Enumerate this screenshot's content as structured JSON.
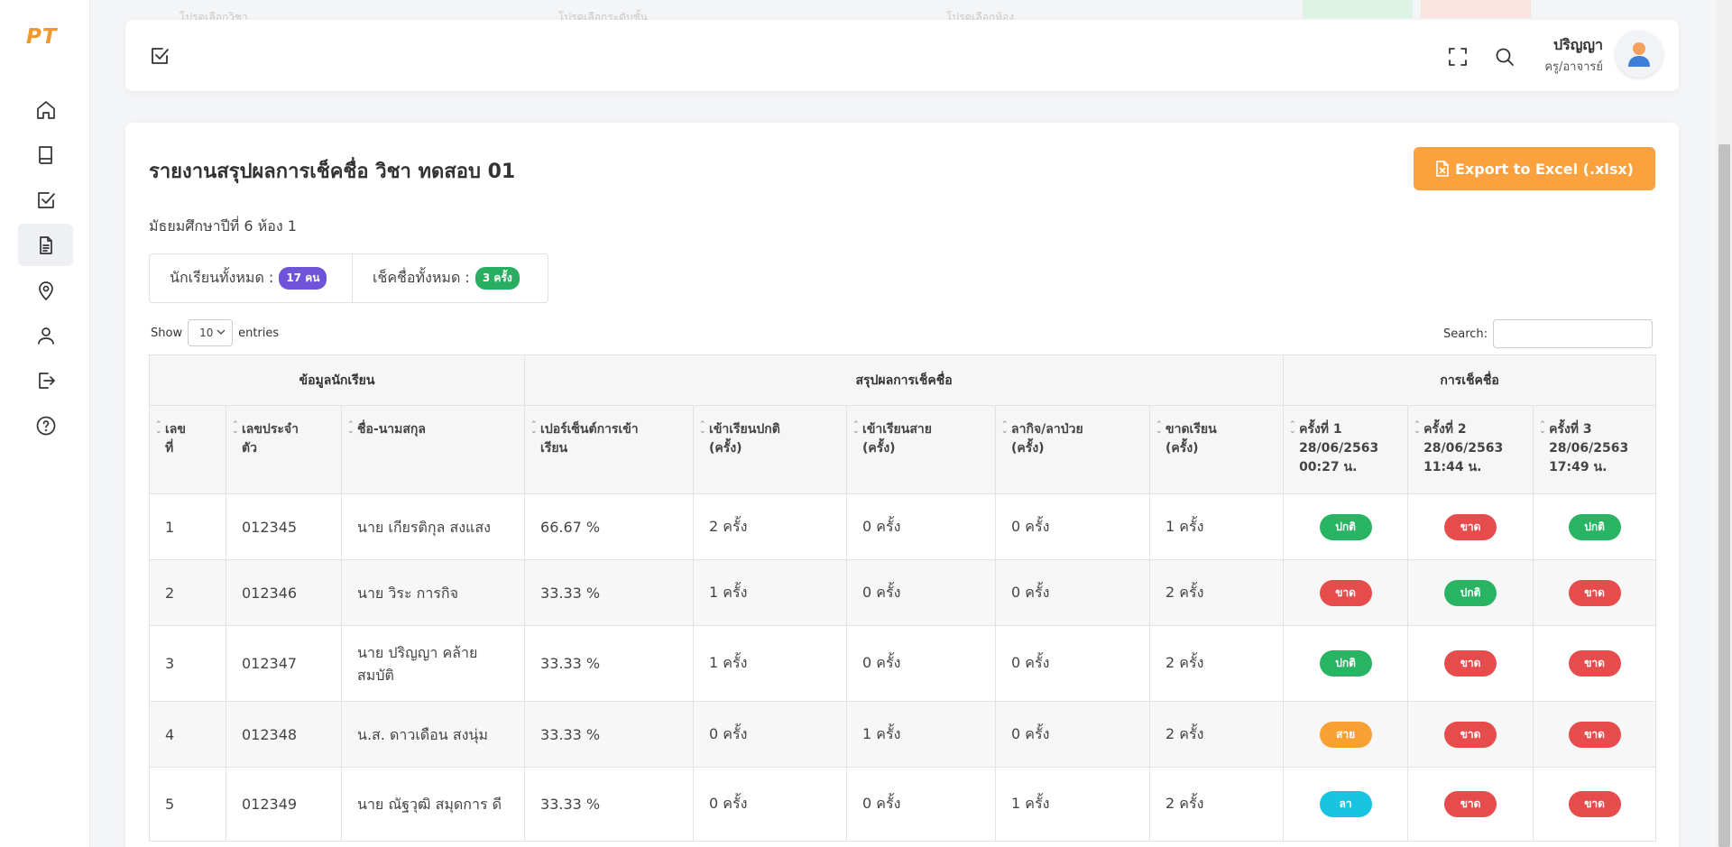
{
  "app": {
    "logo": "PT"
  },
  "sidebar": {
    "items": [
      {
        "name": "home",
        "icon": "home-icon"
      },
      {
        "name": "book",
        "icon": "book-icon"
      },
      {
        "name": "checkin",
        "icon": "checkbox-icon"
      },
      {
        "name": "report",
        "icon": "document-icon",
        "active": true
      },
      {
        "name": "location",
        "icon": "map-pin-icon"
      },
      {
        "name": "profile",
        "icon": "user-icon"
      },
      {
        "name": "logout",
        "icon": "logout-icon"
      },
      {
        "name": "help",
        "icon": "help-icon"
      }
    ]
  },
  "header": {
    "user_name": "ปริญญา",
    "user_role": "ครู/อาจารย์"
  },
  "report": {
    "title": "รายงานสรุปผลการเช็คชื่อ วิชา ทดสอบ 01",
    "export_label": "Export to Excel (.xlsx)",
    "class_label": "มัธยมศึกษาปีที่ 6 ห้อง 1",
    "students_label": "นักเรียนทั้งหมด :",
    "students_count": "17 คน",
    "checks_label": "เช็คชื่อทั้งหมด :",
    "checks_count": "3 ครั้ง"
  },
  "table_controls": {
    "show_label": "Show",
    "entries_value": "10",
    "entries_label": "entries",
    "search_label": "Search:"
  },
  "table": {
    "groups": [
      "ข้อมูลนักเรียน",
      "สรุปผลการเช็คชื่อ",
      "การเช็คชื่อ"
    ],
    "columns": [
      [
        "เลข",
        "ที่"
      ],
      [
        "เลขประจำ",
        "ตัว"
      ],
      [
        "ชื่อ-นามสกุล"
      ],
      [
        "เปอร์เซ็นต์การเข้า",
        "เรียน"
      ],
      [
        "เข้าเรียนปกติ",
        "(ครั้ง)"
      ],
      [
        "เข้าเรียนสาย",
        "(ครั้ง)"
      ],
      [
        "ลากิจ/ลาป่วย",
        "(ครั้ง)"
      ],
      [
        "ขาดเรียน",
        "(ครั้ง)"
      ],
      [
        "ครั้งที่ 1",
        "28/06/2563",
        "00:27 น."
      ],
      [
        "ครั้งที่ 2",
        "28/06/2563",
        "11:44 น."
      ],
      [
        "ครั้งที่ 3",
        "28/06/2563",
        "17:49 น."
      ]
    ],
    "rows": [
      {
        "no": "1",
        "id": "012345",
        "name": "นาย เกียรติกุล สงแสง",
        "percent": "66.67 %",
        "normal": "2 ครั้ง",
        "late": "0 ครั้ง",
        "leave": "0 ครั้ง",
        "absent": "1 ครั้ง",
        "checks": [
          {
            "label": "ปกติ",
            "status": "normal"
          },
          {
            "label": "ขาด",
            "status": "absent"
          },
          {
            "label": "ปกติ",
            "status": "normal"
          }
        ]
      },
      {
        "no": "2",
        "id": "012346",
        "name": "นาย วิระ การกิจ",
        "percent": "33.33 %",
        "normal": "1 ครั้ง",
        "late": "0 ครั้ง",
        "leave": "0 ครั้ง",
        "absent": "2 ครั้ง",
        "checks": [
          {
            "label": "ขาด",
            "status": "absent"
          },
          {
            "label": "ปกติ",
            "status": "normal"
          },
          {
            "label": "ขาด",
            "status": "absent"
          }
        ]
      },
      {
        "no": "3",
        "id": "012347",
        "name": "นาย ปริญญา คล้าย สมบัติ",
        "percent": "33.33 %",
        "normal": "1 ครั้ง",
        "late": "0 ครั้ง",
        "leave": "0 ครั้ง",
        "absent": "2 ครั้ง",
        "checks": [
          {
            "label": "ปกติ",
            "status": "normal"
          },
          {
            "label": "ขาด",
            "status": "absent"
          },
          {
            "label": "ขาด",
            "status": "absent"
          }
        ]
      },
      {
        "no": "4",
        "id": "012348",
        "name": "น.ส. ดาวเดือน สงนุ่ม",
        "percent": "33.33 %",
        "normal": "0 ครั้ง",
        "late": "1 ครั้ง",
        "leave": "0 ครั้ง",
        "absent": "2 ครั้ง",
        "checks": [
          {
            "label": "สาย",
            "status": "late"
          },
          {
            "label": "ขาด",
            "status": "absent"
          },
          {
            "label": "ขาด",
            "status": "absent"
          }
        ]
      },
      {
        "no": "5",
        "id": "012349",
        "name": "นาย ณัฐวุฒิ สมุดการ ดี",
        "percent": "33.33 %",
        "normal": "0 ครั้ง",
        "late": "0 ครั้ง",
        "leave": "1 ครั้ง",
        "absent": "2 ครั้ง",
        "checks": [
          {
            "label": "ลา",
            "status": "leave"
          },
          {
            "label": "ขาด",
            "status": "absent"
          },
          {
            "label": "ขาด",
            "status": "absent"
          }
        ]
      }
    ]
  },
  "background_strip": {
    "text_1": "โปรดเลือกวิชา",
    "text_2": "โปรดเลือกระดับชั้น",
    "text_3": "โปรดเลือกห้อง"
  },
  "colors": {
    "accent": "#fba13d",
    "normal": "#28b463",
    "absent": "#e74c4c",
    "late": "#f9a032",
    "leave": "#17c5e2",
    "students_badge": "#6f53d8",
    "checks_badge": "#27ae60"
  }
}
